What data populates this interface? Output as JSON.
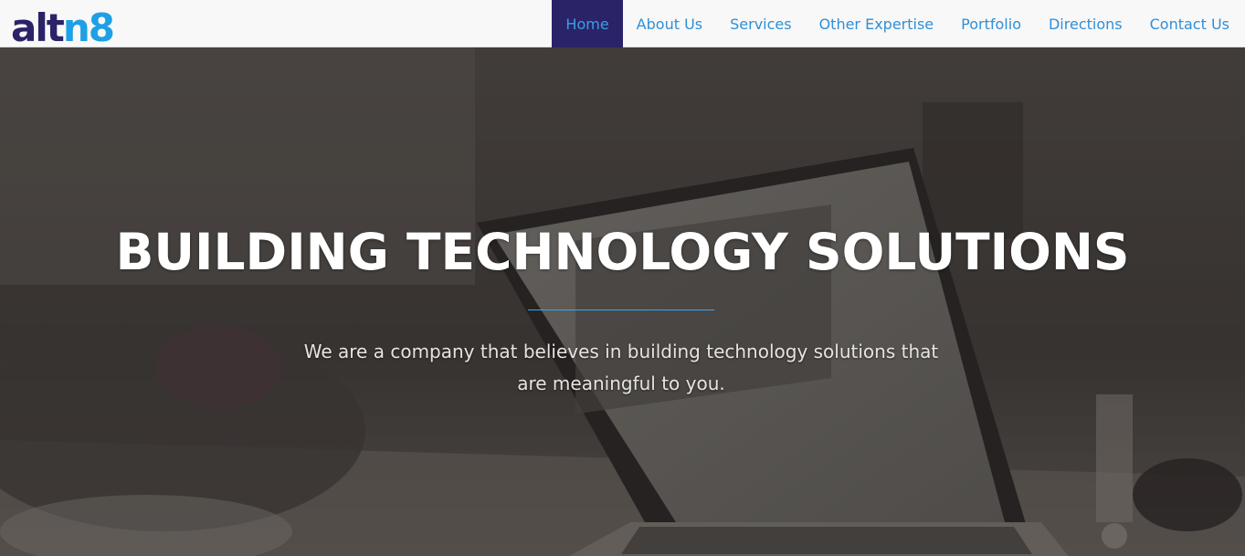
{
  "brand": {
    "logo_text": "altn8",
    "colors": {
      "dark": "#2a2368",
      "light": "#1ea0e6"
    }
  },
  "nav": {
    "items": [
      {
        "label": "Home",
        "active": true
      },
      {
        "label": "About Us"
      },
      {
        "label": "Services"
      },
      {
        "label": "Other Expertise"
      },
      {
        "label": "Portfolio"
      },
      {
        "label": "Directions"
      },
      {
        "label": "Contact Us"
      }
    ],
    "active_color": "#2a2368",
    "link_color": "#2f8fd6"
  },
  "hero": {
    "title": "BUILDING TECHNOLOGY SOLUTIONS",
    "subtitle": "We are a company that believes in building technology solutions that are meaningful to you.",
    "divider_color": "#3aa6e8"
  }
}
